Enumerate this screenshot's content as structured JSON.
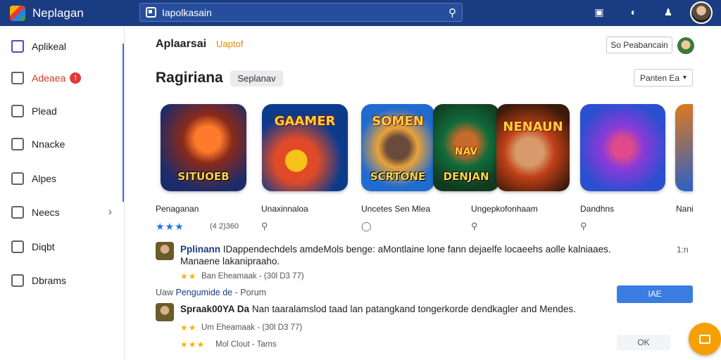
{
  "app": {
    "title": "Neplagan"
  },
  "search": {
    "value": "Iapolkasain"
  },
  "topbar_icons": [
    "inbox-icon",
    "help-icon",
    "add-person-icon"
  ],
  "sidebar": {
    "items": [
      {
        "label": "Aplikeal",
        "icon": "home-icon"
      },
      {
        "label": "Adeaea",
        "icon": "home-icon",
        "badge": "!"
      },
      {
        "label": "Plead",
        "icon": "page-icon"
      },
      {
        "label": "Nnacke",
        "icon": "square-icon"
      },
      {
        "label": "Alpes",
        "icon": "image-icon"
      },
      {
        "label": "Neecs",
        "icon": "people-icon"
      },
      {
        "label": "Diqbt",
        "icon": "book-icon"
      },
      {
        "label": "Dbrams",
        "icon": "user-icon"
      }
    ]
  },
  "header": {
    "title": "Aplaarsai",
    "update_label": "Uaptof",
    "account_button": "So Peabancain"
  },
  "section": {
    "title": "Ragiriana",
    "chip": "Seplanav",
    "sort_dropdown": "Panten Ea"
  },
  "apps": [
    {
      "art_text": "SITUOEB",
      "title": "Penaganan",
      "stars": "★★★",
      "rating": "(4 2)360",
      "colors": [
        "#1c2b6b",
        "#c83c1a"
      ]
    },
    {
      "art_text": "",
      "top_text": "GAAMER",
      "title": "Unaxinnaloa",
      "colors": [
        "#0d3b8c",
        "#e04a28"
      ]
    },
    {
      "art_text": "SCRTONE",
      "top_text": "SOMEN",
      "title": "Uncetes Sen Mlea",
      "colors": [
        "#1f6bd0",
        "#e8a23a"
      ]
    },
    {
      "art_text": "DENJAN",
      "top_text": "NAV",
      "title": "Ungepkofonhaam",
      "colors": [
        "#0f6b3a",
        "#d6a030"
      ]
    },
    {
      "art_text": "",
      "top_text": "NENAUN",
      "title": "Dandhns",
      "colors": [
        "#3a1a0a",
        "#c04018"
      ]
    },
    {
      "art_text": "",
      "title": "Dandhns",
      "colors": [
        "#2a4fd0",
        "#8a3ad8"
      ]
    },
    {
      "art_text": "",
      "title": "Nani",
      "colors": [
        "#e07a1a",
        "#2a60c8"
      ]
    }
  ],
  "reviews": [
    {
      "author": "Pplinann",
      "text": "IDappendechdels amdeMols benge: aMontlaine lone fann dejaelfe locaeehs aolle kalniaaes.",
      "text2": "Manaene lakanipraaho.",
      "stars": "★★",
      "meta": "Ban Eheamaak - (30l D3 77)",
      "time": "1:n"
    },
    {
      "author": "Spraak00YA Da",
      "text": "Nan taaralamslod taad lan patangkand tongerkorde dendkagler and Mendes.",
      "stars": "★★",
      "meta": "Um Eheamaak - (30l D3 77)",
      "meta2": "Mol Clout - Tarns",
      "stars2": "★★★"
    }
  ],
  "sub_line": {
    "prefix": "Uaw",
    "link": "Pengumide de",
    "suffix": "- Porum"
  },
  "buttons": {
    "primary": "IAE",
    "ok": "OK"
  }
}
